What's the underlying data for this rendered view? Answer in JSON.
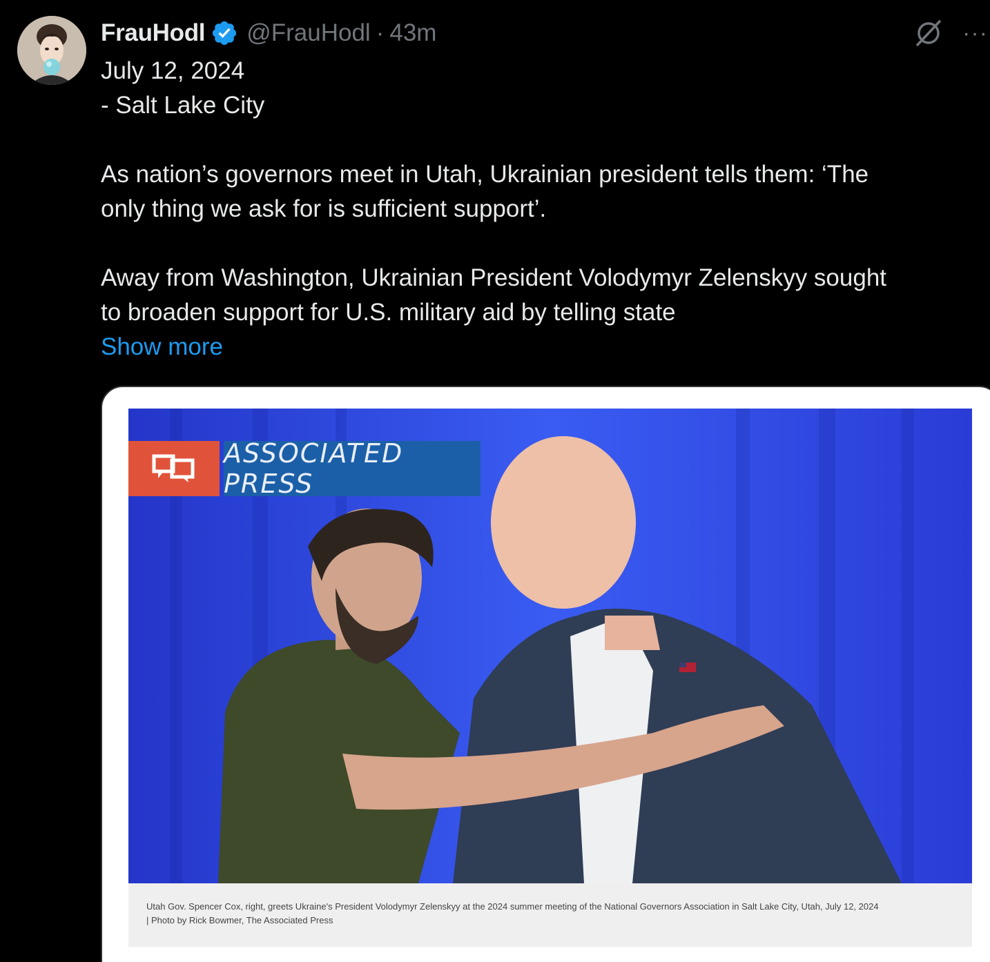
{
  "post": {
    "display_name": "FrauHodl",
    "handle": "@FrauHodl",
    "separator": "·",
    "time": "43m",
    "body_lines": [
      "July 12, 2024",
      "- Salt Lake City",
      "",
      "As nation’s governors meet in Utah, Ukrainian president tells them: ‘The",
      "only thing we ask for is sufficient support’.",
      "",
      "Away from Washington, Ukrainian President Volodymyr Zelenskyy sought",
      "to broaden support for U.S. military aid by telling state"
    ],
    "show_more": "Show more",
    "more_glyph": "···"
  },
  "media": {
    "source_name": "ASSOCIATED PRESS",
    "caption_line1": "Utah Gov. Spencer Cox, right, greets Ukraine's President Volodymyr Zelenskyy at the 2024 summer meeting of the National Governors Association in Salt Lake City, Utah, July 12, 2024",
    "caption_line2": "| Photo by Rick Bowmer, The Associated Press"
  },
  "colors": {
    "background": "#000000",
    "text": "#e7e9ea",
    "muted": "#71767b",
    "link": "#1d9bf0",
    "verified": "#1d9bf0",
    "ap_red": "#e0533a",
    "ap_blue": "#1b5fa8"
  },
  "icons": {
    "avatar": "avatar-image",
    "verified": "verified-badge-icon",
    "grok": "grok-icon",
    "more": "more-options-icon"
  }
}
